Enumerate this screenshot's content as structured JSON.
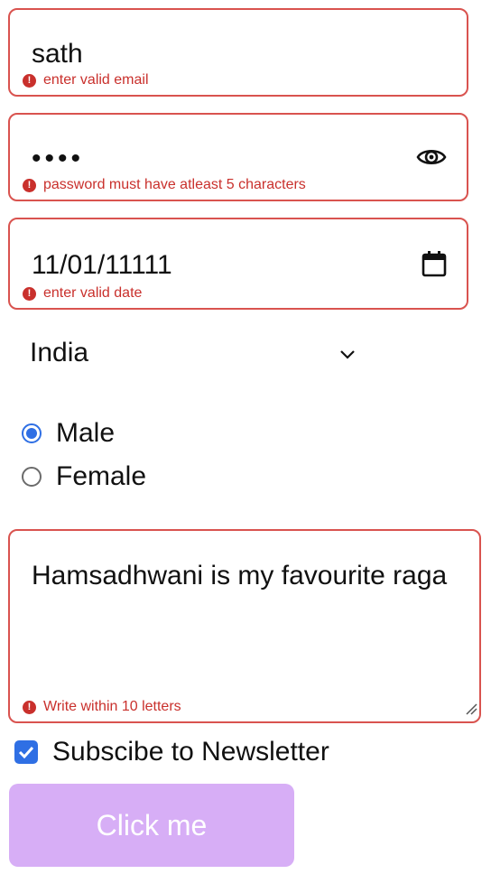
{
  "email": {
    "value": "sath",
    "error": "enter valid email"
  },
  "password": {
    "value": "••••",
    "error": "password must have atleast 5 characters"
  },
  "date": {
    "value": "11/01/11111",
    "error": "enter valid date"
  },
  "country": {
    "value": "India"
  },
  "gender": {
    "options": [
      "Male",
      "Female"
    ],
    "selected": "Male"
  },
  "bio": {
    "value": "Hamsadhwani is my favourite raga",
    "error": "Write within 10 letters"
  },
  "newsletter": {
    "label": "Subscibe to Newsletter",
    "checked": true
  },
  "submit": {
    "label": "Click me"
  },
  "colors": {
    "error": "#c9302c",
    "accent": "#2f6fe4",
    "button": "#d7aef6"
  }
}
